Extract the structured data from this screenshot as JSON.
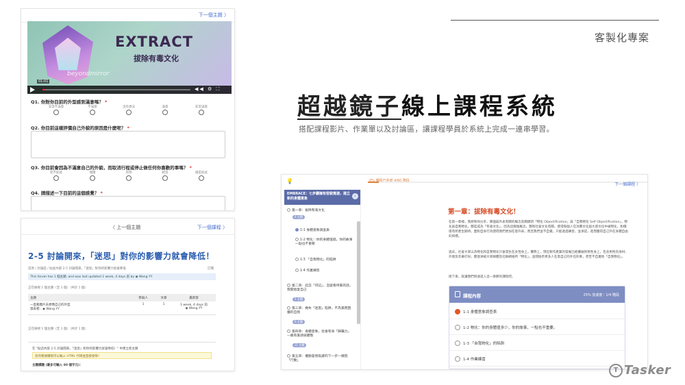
{
  "header": {
    "tag": "客製化專案",
    "title_underlined": "超越鏡子",
    "title_rest": "線上課程系統",
    "subtitle": "搭配課程影片、作業單以及討論區，讓課程學員於系統上完成一連串學習。"
  },
  "shot1": {
    "next_label": "下一個主題 〉",
    "video": {
      "title": "EXTRACT",
      "subtitle": "拔除有毒文化",
      "watermark": "beyondmirror",
      "time": "01:01",
      "icons": "◀◀ ⚙ ⛶"
    },
    "questions": [
      {
        "label": "Q1. 你對你目前的外型感到滿意嗎？",
        "required": "*",
        "options": [
          "非常不滿意",
          "不滿意",
          "沒有想法",
          "滿意",
          "非常滿意"
        ]
      },
      {
        "label": "Q2. 你目前這樣評價自己外貌的原因是什麼呢？",
        "required": "*"
      },
      {
        "label": "Q3. 你目前會因為不滿意自己的外貌，而取消行程或停止做任何你喜歡的事嗎？",
        "required": "*",
        "options": [
          "從不如此",
          "偶爾",
          "有時",
          "經常",
          "總是如此"
        ]
      },
      {
        "label": "Q4. 請描述一下目前的這個感覺？",
        "required": "*"
      }
    ]
  },
  "shot2": {
    "prev_label": "〈 上一個主題",
    "next_label": "下一個課程 〉",
    "title": "2-5 討論開來，「迷思」對你的影響力就會降低！",
    "breadcrumb": "首頁 / 討論區 / 貼此內容 2-5 討論開來，「迷思」對你的影響力就會降低",
    "print_label": "訂閱",
    "info": "This forum has 1 個主題, and was last updated 1 week, 4 days 前 by ◉ Wang YY.",
    "meta_top": "正在檢視 1 個主題（至 1 個）（共計 1 個）",
    "table": {
      "headers": [
        "主題",
        "參與人",
        "文章",
        "最新發"
      ],
      "row": {
        "topic": "一直看圖片去想像自己的外型",
        "author": "發表者：◉ Wang YY",
        "participants": "1",
        "posts": "1",
        "latest": "1 week, 4 days 前",
        "latest_by": "◉ Wang YY"
      }
    },
    "meta_bottom": "正在檢視 1 個主題（至 1 個）（共計 1 個）",
    "post_title": "在 \"貼這內容 2-5 討論開來，「迷思」對你的影響力就會降低！\" 中建立新主題",
    "warning": "您的帳號權限可以輸入 HTML 代碼並直接發佈！",
    "subject_label": "主題標題 (最多可輸入 80 個字元)："
  },
  "shot3": {
    "progress_text": "0% 課程已完成 4/60 階段",
    "progress_value": 0.04,
    "next_label": "下一個課程 〉",
    "sidebar": {
      "header": "EMBRACE：七步驟擁有容貌寬適，建立新的身體意象",
      "items": [
        {
          "label": "第一章：拔除有毒文化",
          "pill": "4 主題"
        },
        {
          "label": "1-1 身體意象調查表"
        },
        {
          "label": "1-2 物化：你的身體值錢，你的故事一點也不重要"
        },
        {
          "label": "1-3 「自我物化」的陷阱"
        },
        {
          "label": "1-4 作業練習"
        },
        {
          "label": "第二章：認怎「印記」，怎麼看待美的話，我開始愛自己",
          "pill": "5 主題"
        },
        {
          "label": "第三章：做失「迷思」陷阱，不為美而困擾的自我",
          "pill": "6 主題"
        },
        {
          "label": "第四章：身體意象，從會有身「歸屬力」—擁有美感與體態",
          "pill": "11 主題"
        },
        {
          "label": "第五章：擺脫容貌焦慮的下一步—擁抱「行動」",
          "pill": ""
        }
      ]
    },
    "chapter_title": "第一章：拔除有毒文化！",
    "paragraphs": [
      "在第一章裡，我想和你分享，兩個與外表有關的概念及關鍵詞「物化 Objectification」與「自我物化 Self Objectification」。物化與自我物化，都是成為「有毒文化」，因為這兩個概念，都和社會文化有關，使得每個人在消費文化與大眾文化中被物化，對價值有所產生期待，面對自身行為使得我們更加在意外表，而且我們並不自覺，只能透過練習，並承認，進而獲得自己外在身體自由的目標。",
      "過去，社會大眾以為物化和自我物化只會發生在女性身上，實際上，現在製作產業的發展已經擴展到男性身上，包含男性的身材、外貌及衣著打扮，都逐漸被大眾媒體及社群網絡所「物化」，並開始有更多人在意自己的外在形象，甚至不自覺地「自我物化」。",
      "接下來，就讓我們快速進入這一章節的課程吧。"
    ],
    "card": {
      "title": "課程內容",
      "stat": "25% 完成度｜1/4 階段",
      "lessons": [
        {
          "label": "1-1 身體意象調查表",
          "done": true
        },
        {
          "label": "1-2 物化：你的身體值多少，你的故事，一點也不重要。",
          "done": false
        },
        {
          "label": "1-3 「自我物化」的陷阱",
          "done": false
        },
        {
          "label": "1-4 作業練習",
          "done": false
        }
      ]
    }
  },
  "logo": {
    "mark": "T",
    "text": "Tasker"
  },
  "colors": {
    "accent_blue": "#2a5db0",
    "accent_orange": "#d64b24",
    "sidebar_header": "#5b6ba8",
    "card_header": "#7e8ec3"
  }
}
